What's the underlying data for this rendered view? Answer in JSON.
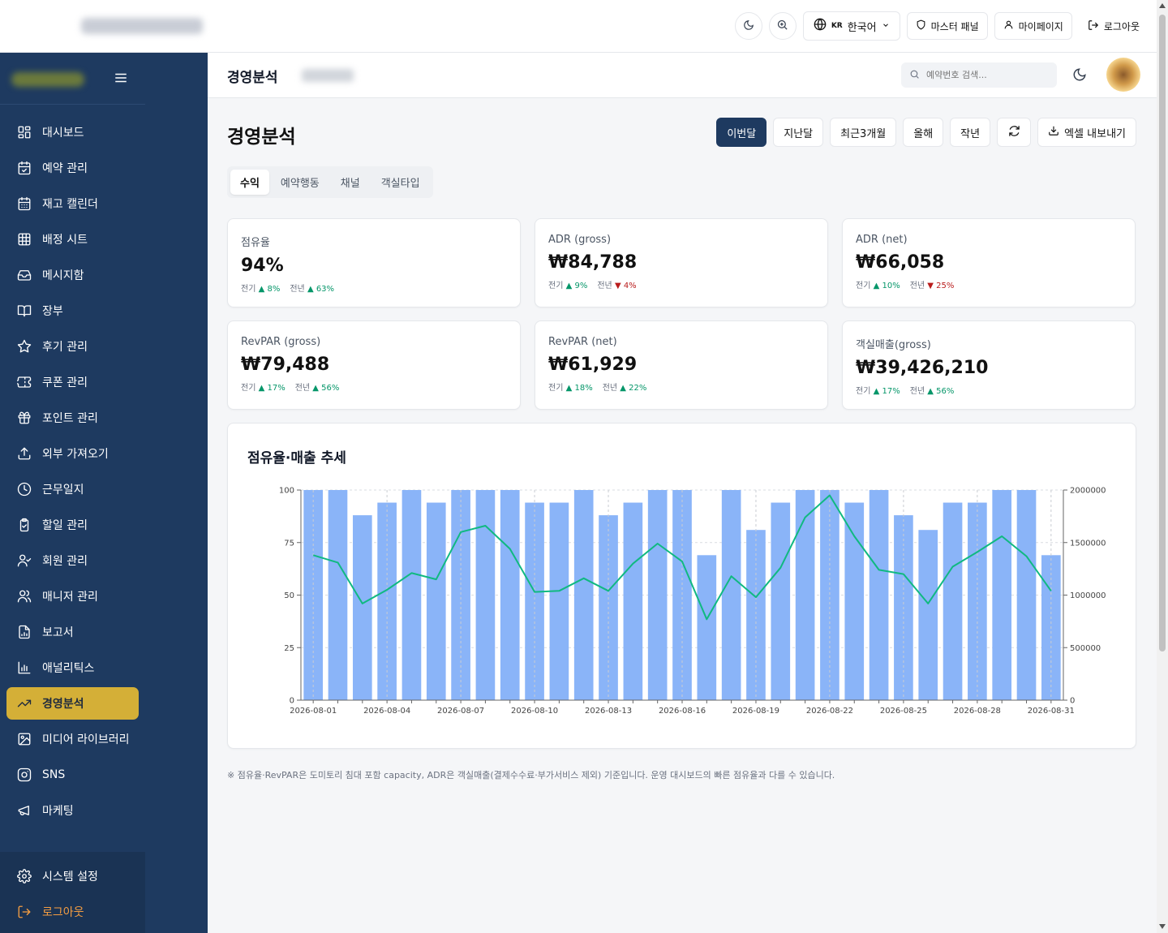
{
  "topbar": {
    "lang_code": "KR",
    "lang_label": "한국어",
    "master_panel": "마스터 패널",
    "mypage": "마이페이지",
    "logout": "로그아웃"
  },
  "sidebar": {
    "items": [
      {
        "label": "대시보드",
        "icon": "grid-icon"
      },
      {
        "label": "예약 관리",
        "icon": "calendar-check-icon"
      },
      {
        "label": "재고 캘린더",
        "icon": "calendar-icon"
      },
      {
        "label": "배정 시트",
        "icon": "table-icon"
      },
      {
        "label": "메시지함",
        "icon": "inbox-icon"
      },
      {
        "label": "장부",
        "icon": "book-icon"
      },
      {
        "label": "후기 관리",
        "icon": "star-icon"
      },
      {
        "label": "쿠폰 관리",
        "icon": "ticket-icon"
      },
      {
        "label": "포인트 관리",
        "icon": "gift-icon"
      },
      {
        "label": "외부 가져오기",
        "icon": "upload-icon"
      },
      {
        "label": "근무일지",
        "icon": "clock-icon"
      },
      {
        "label": "할일 관리",
        "icon": "clipboard-check-icon"
      },
      {
        "label": "회원 관리",
        "icon": "user-check-icon"
      },
      {
        "label": "매니저 관리",
        "icon": "users-icon"
      },
      {
        "label": "보고서",
        "icon": "file-chart-icon"
      },
      {
        "label": "애널리틱스",
        "icon": "bar-chart-icon"
      },
      {
        "label": "경영분석",
        "icon": "trending-up-icon"
      },
      {
        "label": "미디어 라이브러리",
        "icon": "image-icon"
      },
      {
        "label": "SNS",
        "icon": "instagram-icon"
      },
      {
        "label": "마케팅",
        "icon": "megaphone-icon"
      }
    ],
    "active_index": 16,
    "settings": "시스템 설정",
    "logout": "로그아웃"
  },
  "header": {
    "title": "경영분석",
    "search_placeholder": "예약번호 검색..."
  },
  "main": {
    "title": "경영분석",
    "periods": [
      "이번달",
      "지난달",
      "최근3개월",
      "올해",
      "작년"
    ],
    "active_period": 0,
    "export_label": "엑셀 내보내기",
    "tabs": [
      "수익",
      "예약행동",
      "채널",
      "객실타입"
    ],
    "active_tab": 0,
    "cards": [
      {
        "label": "점유율",
        "value": "94%",
        "prev_label": "전기",
        "prev_dir": "up",
        "prev_val": "8%",
        "year_label": "전년",
        "year_dir": "up",
        "year_val": "63%"
      },
      {
        "label": "ADR (gross)",
        "value": "₩84,788",
        "prev_label": "전기",
        "prev_dir": "up",
        "prev_val": "9%",
        "year_label": "전년",
        "year_dir": "down",
        "year_val": "4%"
      },
      {
        "label": "ADR (net)",
        "value": "₩66,058",
        "prev_label": "전기",
        "prev_dir": "up",
        "prev_val": "10%",
        "year_label": "전년",
        "year_dir": "down",
        "year_val": "25%"
      },
      {
        "label": "RevPAR (gross)",
        "value": "₩79,488",
        "prev_label": "전기",
        "prev_dir": "up",
        "prev_val": "17%",
        "year_label": "전년",
        "year_dir": "up",
        "year_val": "56%"
      },
      {
        "label": "RevPAR (net)",
        "value": "₩61,929",
        "prev_label": "전기",
        "prev_dir": "up",
        "prev_val": "18%",
        "year_label": "전년",
        "year_dir": "up",
        "year_val": "22%"
      },
      {
        "label": "객실매출(gross)",
        "value": "₩39,426,210",
        "prev_label": "전기",
        "prev_dir": "up",
        "prev_val": "17%",
        "year_label": "전년",
        "year_dir": "up",
        "year_val": "56%"
      }
    ],
    "note": "※ 점유율·RevPAR은 도미토리 침대 포함 capacity, ADR은 객실매출(결제수수료·부가서비스 제외) 기준입니다. 운영 대시보드의 빠른 점유율과 다를 수 있습니다."
  },
  "chart_data": {
    "type": "bar",
    "title": "점유율·매출 추세",
    "x": [
      "2026-08-01",
      "2026-08-02",
      "2026-08-03",
      "2026-08-04",
      "2026-08-05",
      "2026-08-06",
      "2026-08-07",
      "2026-08-08",
      "2026-08-09",
      "2026-08-10",
      "2026-08-11",
      "2026-08-12",
      "2026-08-13",
      "2026-08-14",
      "2026-08-15",
      "2026-08-16",
      "2026-08-17",
      "2026-08-18",
      "2026-08-19",
      "2026-08-20",
      "2026-08-21",
      "2026-08-22",
      "2026-08-23",
      "2026-08-24",
      "2026-08-25",
      "2026-08-26",
      "2026-08-27",
      "2026-08-28",
      "2026-08-29",
      "2026-08-30",
      "2026-08-31"
    ],
    "x_tick_labels": [
      "2026-08-01",
      "2026-08-04",
      "2026-08-07",
      "2026-08-10",
      "2026-08-13",
      "2026-08-16",
      "2026-08-19",
      "2026-08-22",
      "2026-08-25",
      "2026-08-28",
      "2026-08-31"
    ],
    "series": [
      {
        "kind": "bar",
        "axis": "left",
        "color": "#8ab4f8",
        "values": [
          100,
          100,
          88,
          94,
          100,
          94,
          100,
          100,
          100,
          94,
          94,
          100,
          88,
          94,
          100,
          100,
          69,
          100,
          81,
          94,
          100,
          100,
          94,
          100,
          88,
          81,
          94,
          94,
          100,
          100,
          69
        ]
      },
      {
        "kind": "line",
        "axis": "right",
        "color": "#10b981",
        "values": [
          1380000,
          1310000,
          920000,
          1050000,
          1210000,
          1150000,
          1600000,
          1660000,
          1440000,
          1030000,
          1040000,
          1160000,
          1040000,
          1300000,
          1490000,
          1320000,
          770000,
          1180000,
          980000,
          1260000,
          1740000,
          1950000,
          1560000,
          1240000,
          1200000,
          920000,
          1270000,
          1410000,
          1560000,
          1370000,
          1040000
        ]
      }
    ],
    "ylim_left": [
      0,
      100
    ],
    "yticks_left": [
      0,
      25,
      50,
      75,
      100
    ],
    "ylim_right": [
      0,
      2000000
    ],
    "yticks_right": [
      0,
      500000,
      1000000,
      1500000,
      2000000
    ],
    "grid": true
  }
}
